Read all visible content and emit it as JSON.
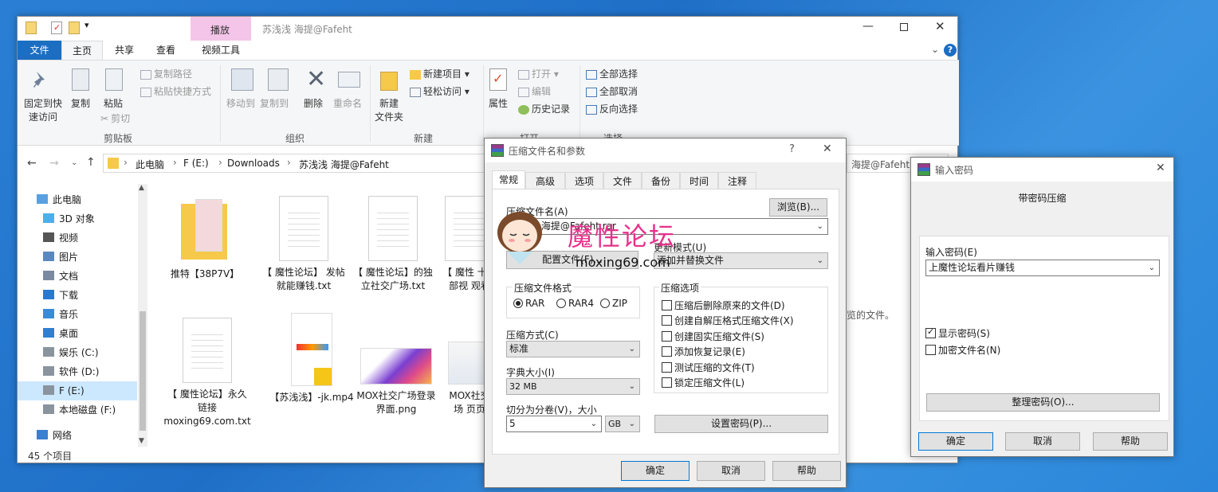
{
  "explorer": {
    "title": "苏浅浅 海提@Fafeht",
    "context_tab": "播放",
    "tabs": [
      "文件",
      "主页",
      "共享",
      "查看",
      "视频工具"
    ],
    "clipboard": {
      "pin": "固定到快",
      "pin2": "速访问",
      "copy": "复制",
      "paste": "粘贴",
      "copy_path": "复制路径",
      "paste_shortcut": "粘贴快捷方式",
      "cut": "剪切",
      "group": "剪贴板"
    },
    "organize": {
      "move": "移动到",
      "copy_to": "复制到",
      "delete": "删除",
      "rename": "重命名",
      "group": "组织"
    },
    "new": {
      "new_folder": "新建",
      "new_folder2": "文件夹",
      "new_item": "新建项目",
      "easy_access": "轻松访问",
      "group": "新建"
    },
    "open": {
      "properties": "属性",
      "open": "打开",
      "edit": "编辑",
      "history": "历史记录",
      "group": "打开"
    },
    "select": {
      "select_all": "全部选择",
      "select_none": "全部取消",
      "invert": "反向选择",
      "group": "选择"
    },
    "address": [
      "此电脑",
      "F (E:)",
      "Downloads",
      "苏浅浅 海提@Fafeht"
    ],
    "search_placeholder": "海提@Fafeht\"",
    "nav": [
      "此电脑",
      "3D 对象",
      "视频",
      "图片",
      "文档",
      "下载",
      "音乐",
      "桌面",
      "娱乐 (C:)",
      "软件 (D:)",
      "F (E:)",
      "本地磁盘 (F:)",
      "网络"
    ],
    "files": [
      {
        "name": "推特【38P7V】"
      },
      {
        "name": "【 魔性论坛】 发帖就能赚钱.txt"
      },
      {
        "name": "【 魔性论坛】的独立社交广场.txt"
      },
      {
        "name": "【 魔性 十万部视 观看"
      },
      {
        "name": "【 魔性论坛】永久链接 moxing69.com.txt"
      },
      {
        "name": "【苏浅浅】-jk.mp4"
      },
      {
        "name": "MOX社交广场登录界面.png"
      },
      {
        "name": "MOX社交广场 页页面"
      }
    ],
    "status": "45 个项目",
    "preview_hint": "览的文件。"
  },
  "rar": {
    "title": "压缩文件名和参数",
    "help_glyph": "?",
    "tabs": [
      "常规",
      "高级",
      "选项",
      "文件",
      "备份",
      "时间",
      "注释"
    ],
    "archive_label": "压缩文件名(A)",
    "archive_value": "苏浅浅 海提@Fafeht.rar",
    "browse": "浏览(B)...",
    "profile": "配置文件(F)...",
    "update_label": "更新模式(U)",
    "update_value": "添加并替换文件",
    "format_label": "压缩文件格式",
    "formats": [
      "RAR",
      "RAR4",
      "ZIP"
    ],
    "options_label": "压缩选项",
    "options": [
      "压缩后删除原来的文件(D)",
      "创建自解压格式压缩文件(X)",
      "创建固实压缩文件(S)",
      "添加恢复记录(E)",
      "测试压缩的文件(T)",
      "锁定压缩文件(L)"
    ],
    "method_label": "压缩方式(C)",
    "method_value": "标准",
    "dict_label": "字典大小(I)",
    "dict_value": "32 MB",
    "split_label": "切分为分卷(V)，大小",
    "split_value": "5",
    "split_unit": "GB",
    "set_password": "设置密码(P)...",
    "ok": "确定",
    "cancel": "取消",
    "help": "帮助"
  },
  "watermark": {
    "title": "魔性论坛",
    "url": "moxing69.com"
  },
  "pwd": {
    "title": "输入密码",
    "heading": "带密码压缩",
    "input_label": "输入密码(E)",
    "input_value": "上魔性论坛看片赚钱",
    "show": "显示密码(S)",
    "encrypt_names": "加密文件名(N)",
    "organize": "整理密码(O)...",
    "ok": "确定",
    "cancel": "取消",
    "help": "帮助"
  },
  "colors": {
    "accent": "#1b6ec2",
    "context_tab": "#f4c5e8",
    "watermark": "#e8308a"
  }
}
